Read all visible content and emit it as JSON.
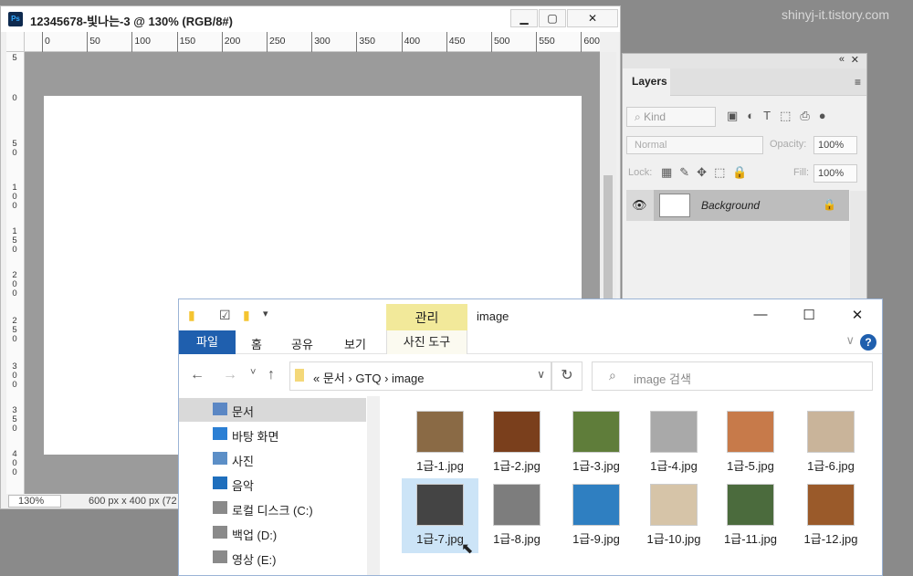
{
  "watermark": "shinyj-it.tistory.com",
  "ps": {
    "logo": "Ps",
    "doc_title": "12345678-빛나는-3 @ 130% (RGB/8#)",
    "buttons": {
      "minimize": "▁",
      "maximize": "▢",
      "close": "✕"
    },
    "ruler_h": [
      "0",
      "50",
      "100",
      "150",
      "200",
      "250",
      "300",
      "350",
      "400",
      "450",
      "500",
      "550",
      "600"
    ],
    "ruler_v": [
      "5",
      "0",
      "50",
      "100",
      "150",
      "200",
      "250",
      "300",
      "350",
      "400"
    ],
    "zoom": "130%",
    "doc_size": "600 px x 400 px (72"
  },
  "layers": {
    "collapse": "«",
    "close": "✕",
    "tab": "Layers",
    "menu": "≡",
    "kind_label": "Kind",
    "kind_icons": "▣◐T⬚⎙●",
    "blend_mode": "Normal",
    "opacity_label": "Opacity:",
    "opacity_value": "100%",
    "lock_label": "Lock:",
    "lock_icons": "▦✎✥⬚🔒",
    "fill_label": "Fill:",
    "fill_value": "100%",
    "layer_name": "Background",
    "eye": "👁",
    "layer_lock": "🔒"
  },
  "explorer": {
    "manage_label": "관리",
    "title": "image",
    "file_tab": "파일",
    "tabs": [
      "홈",
      "공유",
      "보기"
    ],
    "photo_tools": "사진 도구",
    "help": "?",
    "expand": "∨",
    "win_buttons": {
      "minimize": "—",
      "maximize": "☐",
      "close": "✕"
    },
    "nav": {
      "back": "←",
      "forward": "→",
      "recent": "˅",
      "up": "↑"
    },
    "address": "« 문서 › GTQ › image",
    "address_drop": "∨",
    "refresh": "↻",
    "search_placeholder": "image 검색",
    "sidebar": [
      {
        "label": "문서",
        "icon_color": "#5b87c4"
      },
      {
        "label": "바탕 화면",
        "icon_color": "#2b7fd4"
      },
      {
        "label": "사진",
        "icon_color": "#5c8fc7"
      },
      {
        "label": "음악",
        "icon_color": "#1f6fbd"
      },
      {
        "label": "로컬 디스크 (C:)",
        "icon_color": "#8a8a8a"
      },
      {
        "label": "백업 (D:)",
        "icon_color": "#8a8a8a"
      },
      {
        "label": "영상 (E:)",
        "icon_color": "#8a8a8a"
      }
    ],
    "files": [
      {
        "name": "1급-1.jpg",
        "color": "#8a6a45"
      },
      {
        "name": "1급-2.jpg",
        "color": "#7a3f1c"
      },
      {
        "name": "1급-3.jpg",
        "color": "#5f7d3a"
      },
      {
        "name": "1급-4.jpg",
        "color": "#a9a9a9"
      },
      {
        "name": "1급-5.jpg",
        "color": "#c77a4a"
      },
      {
        "name": "1급-6.jpg",
        "color": "#c9b49a"
      },
      {
        "name": "1급-7.jpg",
        "color": "#444444"
      },
      {
        "name": "1급-8.jpg",
        "color": "#7d7d7d"
      },
      {
        "name": "1급-9.jpg",
        "color": "#2f7fc1"
      },
      {
        "name": "1급-10.jpg",
        "color": "#d6c4a8"
      },
      {
        "name": "1급-11.jpg",
        "color": "#4b6b3d"
      },
      {
        "name": "1급-12.jpg",
        "color": "#9a5a2a"
      }
    ]
  }
}
